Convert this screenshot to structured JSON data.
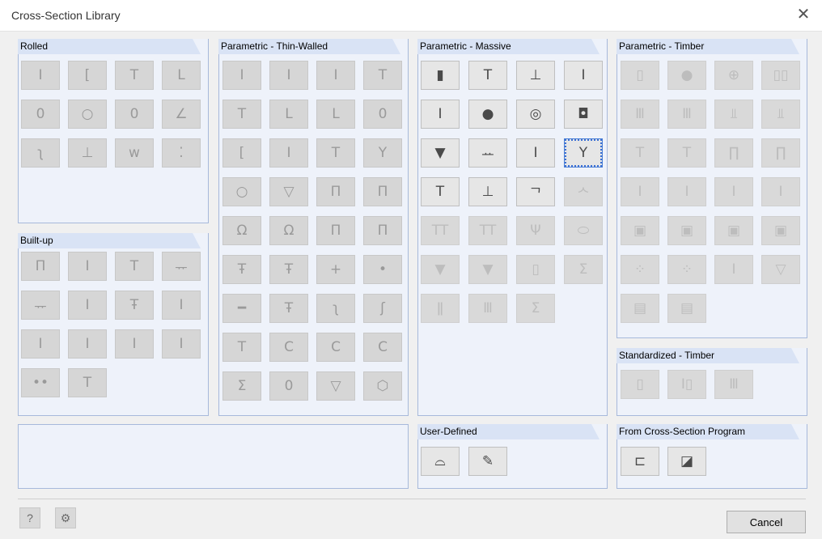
{
  "window": {
    "title": "Cross-Section Library",
    "close_icon": "close-icon"
  },
  "panels": {
    "rolled": {
      "label": "Rolled",
      "items": [
        "Ι",
        "[",
        "T",
        "L",
        "0",
        "○",
        "0",
        "∠",
        "ʅ",
        "⊥",
        "w",
        "⁚"
      ]
    },
    "builtup": {
      "label": "Built-up",
      "items": [
        "Π",
        "Ι",
        "T",
        "ᅲ",
        "ᅲ",
        "Ι",
        "Ŧ",
        "Ι",
        "I",
        "Ι",
        "I",
        "Ι",
        "••",
        "Τ"
      ]
    },
    "thin": {
      "label": "Parametric - Thin-Walled",
      "items": [
        "Ι",
        "Ι",
        "Ι",
        "T",
        "T",
        "L",
        "L",
        "0",
        "[",
        "Ι",
        "T",
        "Υ",
        "○",
        "▽",
        "Π",
        "Π",
        "Ω",
        "Ω",
        "Π",
        "Π",
        "Ŧ",
        "Ŧ",
        "+",
        "•",
        "━",
        "Ŧ",
        "ʅ",
        "ʃ",
        "T",
        "Ⅽ",
        "Ⅽ",
        "Ⅽ",
        "Σ",
        "0",
        "▽",
        "⬡"
      ]
    },
    "massive": {
      "label": "Parametric - Massive",
      "items": [
        "▮",
        "T",
        "⊥",
        "Ι",
        "Ι",
        "●",
        "◎",
        "◘",
        "▼",
        "ᅭ",
        "Ι",
        "Υ",
        "T",
        "⊥",
        "ᄀ",
        "ᄉ",
        "TT",
        "TT",
        "Ψ",
        "⬭",
        "▼",
        "▼",
        "▯",
        "Σ",
        "ǁ",
        "Ⅲ",
        "Σ"
      ]
    },
    "timber": {
      "label": "Parametric - Timber",
      "items": [
        "▯",
        "●",
        "⊕",
        "▯▯",
        "Ⅲ",
        "Ⅲ",
        "⫫",
        "⫫",
        "T",
        "T",
        "∏",
        "∏",
        "Ι",
        "Ι",
        "Ι",
        "Ι",
        "▣",
        "▣",
        "▣",
        "▣",
        "⁘",
        "⁘",
        "Ι",
        "▽",
        "▤",
        "▤"
      ]
    },
    "std_timber": {
      "label": "Standardized - Timber",
      "items": [
        "▯",
        "Ι▯",
        "Ⅲ"
      ]
    },
    "user": {
      "label": "User-Defined",
      "items": [
        "⌓",
        "✎"
      ]
    },
    "program": {
      "label": "From Cross-Section Program",
      "items": [
        "⊏",
        "◪"
      ]
    }
  },
  "footer": {
    "help_icon": "help-icon",
    "info_icon": "info-icon",
    "cancel_label": "Cancel"
  }
}
